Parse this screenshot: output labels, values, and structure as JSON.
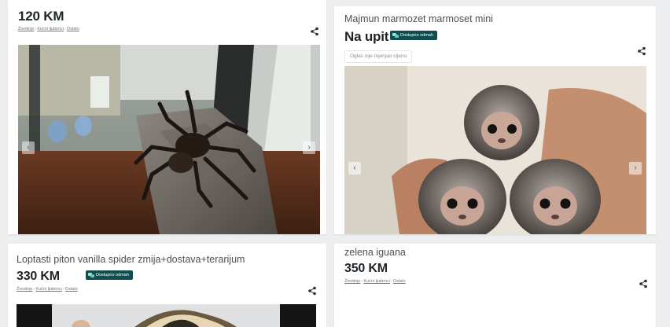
{
  "listings": [
    {
      "price": "120 KM",
      "breadcrumbs": [
        "Životinje",
        "Kućni ljubimci",
        "Ostalo"
      ],
      "image": "tarantula-in-terrarium-photo"
    },
    {
      "title": "Majmun marmozet marmoset mini",
      "price": "Na upit",
      "badge": "Dostupno odmah",
      "price_note": "Ogłas nije mjenjao cijenu",
      "image": "marmoset-monkeys-in-hand-photo"
    },
    {
      "title": "Loptasti piton vanilla spider zmija+dostava+terarijum",
      "price": "330 KM",
      "badge": "Dostupno odmah",
      "breadcrumbs": [
        "Životinje",
        "Kućni ljubimci",
        "Ostalo"
      ],
      "image": "ball-python-photo"
    },
    {
      "title": "zelena iguana",
      "price": "350 KM",
      "breadcrumbs": [
        "Životinje",
        "Kućni ljubimci",
        "Ostalo"
      ]
    }
  ],
  "icons": {
    "share": "share-icon",
    "prev": "chevron-left-icon",
    "next": "chevron-right-icon",
    "badge": "chat-bubbles-icon"
  },
  "colors": {
    "badge_bg": "#0f4d4f",
    "price": "#1d2326",
    "background": "#eceef0"
  }
}
